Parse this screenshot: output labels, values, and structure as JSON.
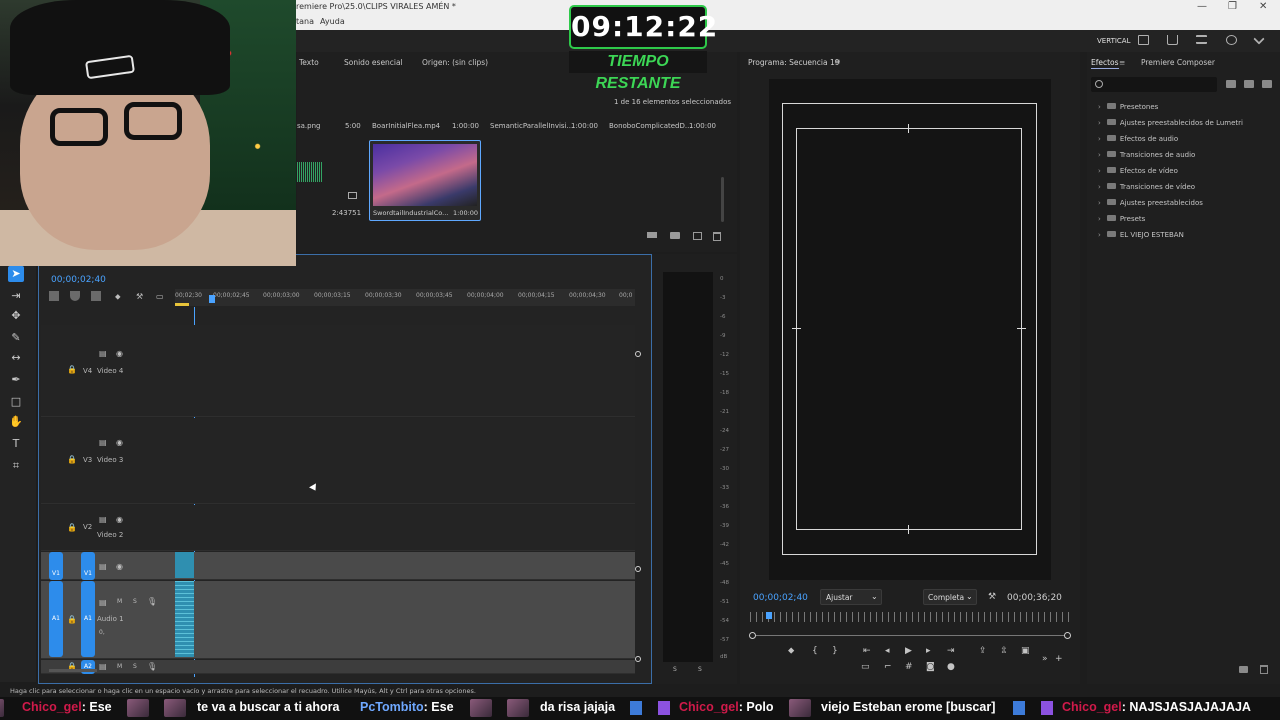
{
  "window": {
    "title": "remiere Pro\\25.0\\CLIPS VIRALES AMÉN *",
    "menus": [
      "tana",
      "Ayuda"
    ],
    "controls": [
      "—",
      "❐",
      "✕"
    ]
  },
  "countdown": {
    "time": "09:12:22",
    "label": "TIEMPO RESTANTE"
  },
  "workspace": {
    "label": "VERTICAL"
  },
  "project": {
    "tabs": [
      "Texto",
      "Sonido esencial",
      "Origen: (sin clips)"
    ],
    "selection_info": "1 de 16 elementos seleccionados",
    "items": [
      {
        "name": "sa.png",
        "duration": "5:00"
      },
      {
        "name": "BoarInitialFlea.mp4",
        "duration": "1:00:00"
      },
      {
        "name": "SemanticParallelInvisi...",
        "duration": "1:00:00"
      },
      {
        "name": "BonoboComplicatedD...",
        "duration": "1:00:00"
      }
    ],
    "left_duration": "2:43751",
    "selected_clip": {
      "name": "SwordtailIndustrialCo...",
      "duration": "1:00:00"
    }
  },
  "timeline": {
    "timecode": "00;00;02;40",
    "ruler": [
      "00;02;30",
      "00;00;02;45",
      "00;00;03;00",
      "00;00;03;15",
      "00;00;03;30",
      "00;00;03;45",
      "00;00;04;00",
      "00;00;04;15",
      "00;00;04;30",
      "00;0"
    ],
    "tracks": [
      {
        "id": "V4",
        "name": "Video 4"
      },
      {
        "id": "V3",
        "name": "Video 3"
      },
      {
        "id": "V2",
        "name": "Video 2"
      },
      {
        "id": "V1",
        "src": "V1"
      },
      {
        "id": "A1",
        "name": "Audio 1",
        "src": "A1",
        "level": "0,"
      },
      {
        "id": "A2",
        "src": "A2"
      }
    ]
  },
  "meters": {
    "ticks": [
      "0",
      "-3",
      "-6",
      "-9",
      "-12",
      "-15",
      "-18",
      "-21",
      "-24",
      "-27",
      "-30",
      "-33",
      "-36",
      "-39",
      "-42",
      "-45",
      "-48",
      "-51",
      "-54",
      "-57",
      "dB"
    ],
    "solo": [
      "S",
      "S"
    ]
  },
  "program": {
    "title": "Programa: Secuencia 19",
    "timecode": "00;00;02;40",
    "zoom": "Ajustar",
    "quality": "Completa",
    "duration": "00;00;36;20"
  },
  "effects": {
    "tabs": [
      "Efectos",
      "Premiere Composer"
    ],
    "items": [
      "Presetones",
      "Ajustes preestablecidos de Lumetri",
      "Efectos de audio",
      "Transiciones de audio",
      "Efectos de vídeo",
      "Transiciones de vídeo",
      "Ajustes preestablecidos",
      "Presets",
      "EL VIEJO ESTEBAN"
    ]
  },
  "status": "Haga clic para seleccionar o haga clic en un espacio vacío y arrastre para seleccionar el recuadro. Utilice Mayús, Alt y Ctrl para otras opciones.",
  "chat": [
    {
      "user": "Chico_gel",
      "text": ": Ese"
    },
    {
      "text": "te va a buscar a ti ahora"
    },
    {
      "user": "PcTombito",
      "text": ": Ese"
    },
    {
      "text": "da risa jajaja"
    },
    {
      "user": "Chico_gel",
      "text": ": Polo"
    },
    {
      "text": "viejo Esteban erome [buscar]"
    },
    {
      "user": "Chico_gel",
      "text": ": NAJSJASJAJAJAJA"
    }
  ],
  "colors": {
    "accent": "#2d8ceb",
    "countdown_green": "#2ec94a",
    "chat_user": "#d01a4a"
  }
}
